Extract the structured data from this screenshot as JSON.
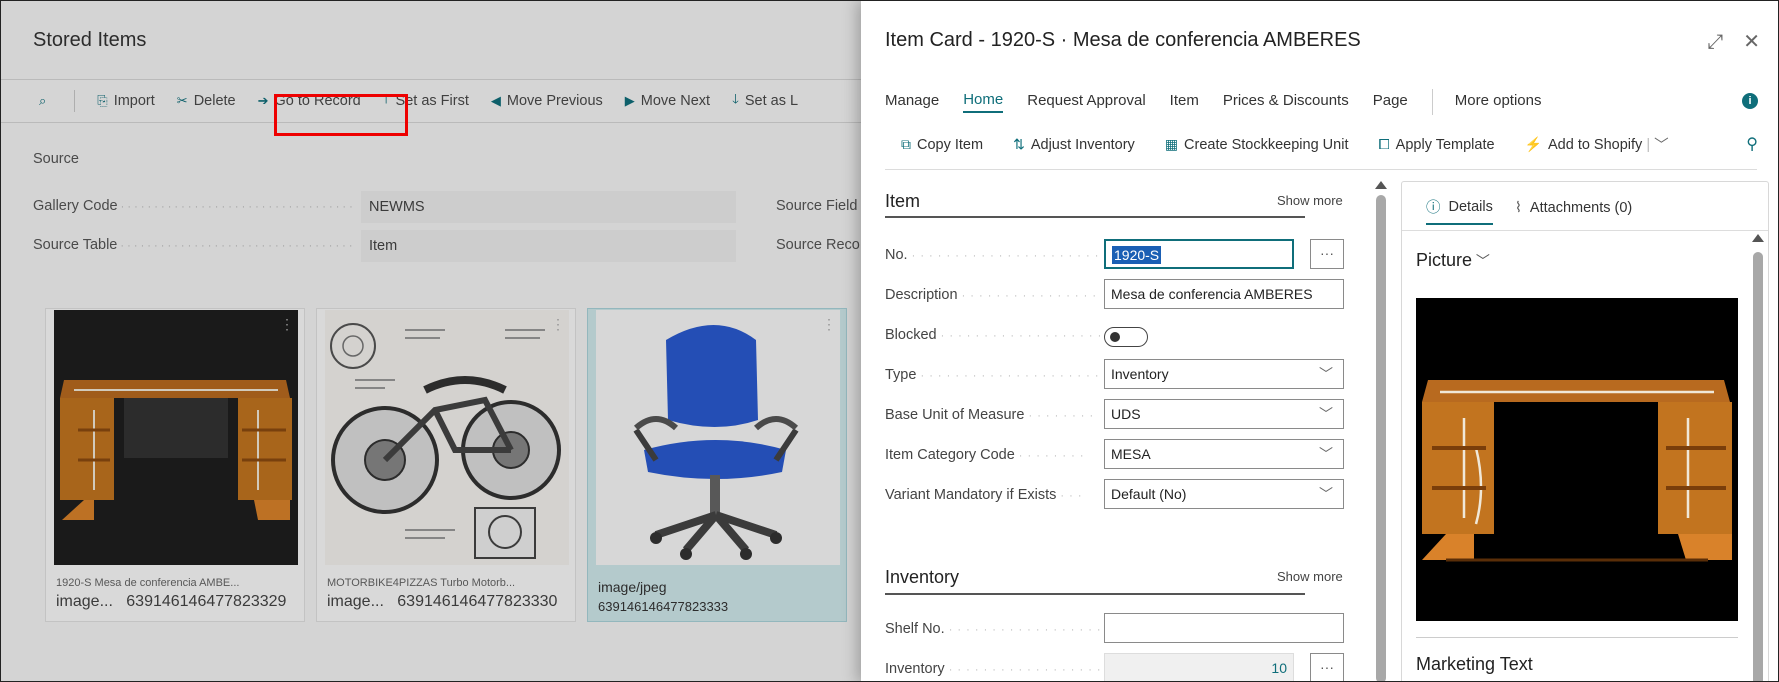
{
  "background_page": {
    "title": "Stored Items",
    "actions": [
      {
        "icon": "search-icon",
        "label": ""
      },
      {
        "icon": "import-icon",
        "label": "Import"
      },
      {
        "icon": "delete-icon",
        "label": "Delete"
      },
      {
        "icon": "arrow-right-icon",
        "label": "Go to Record"
      },
      {
        "icon": "arrow-up-icon",
        "label": "Set as First"
      },
      {
        "icon": "triangle-left-icon",
        "label": "Move Previous"
      },
      {
        "icon": "triangle-right-icon",
        "label": "Move Next"
      },
      {
        "icon": "arrow-down-icon",
        "label": "Set as L"
      }
    ],
    "source_heading": "Source",
    "gallery_code_label": "Gallery Code",
    "gallery_code_value": "NEWMS",
    "source_table_label": "Source Table",
    "source_table_value": "Item",
    "source_field_label": "Source Field",
    "source_record_label": "Source Reco",
    "tiles": [
      {
        "caption": "1920-S Mesa de conferencia AMBE...",
        "type": "image...",
        "id": "639146146477823329",
        "picture": "conference-table"
      },
      {
        "caption": "MOTORBIKE4PIZZAS Turbo Motorb...",
        "type": "image...",
        "id": "639146146477823330",
        "picture": "motorbike-sketch"
      },
      {
        "caption": "image/jpeg",
        "type": "",
        "id": "639146146477823333",
        "picture": "office-chair"
      }
    ]
  },
  "item_card": {
    "title": "Item Card - 1920-S · Mesa de conferencia AMBERES",
    "tabs": [
      "Manage",
      "Home",
      "Request Approval",
      "Item",
      "Prices & Discounts",
      "Page"
    ],
    "active_tab": "Home",
    "more_options": "More options",
    "commands": [
      {
        "icon": "copy-icon",
        "label": "Copy Item"
      },
      {
        "icon": "adjust-inventory-icon",
        "label": "Adjust Inventory"
      },
      {
        "icon": "stockkeeping-icon",
        "label": "Create Stockkeeping Unit"
      },
      {
        "icon": "template-icon",
        "label": "Apply Template"
      },
      {
        "icon": "shopify-icon",
        "label": "Add to Shopify"
      }
    ],
    "item_section": {
      "heading": "Item",
      "show_more": "Show more",
      "fields": {
        "no_label": "No.",
        "no_value": "1920-S",
        "description_label": "Description",
        "description_value": "Mesa de conferencia AMBERES",
        "blocked_label": "Blocked",
        "type_label": "Type",
        "type_value": "Inventory",
        "base_unit_label": "Base Unit of Measure",
        "base_unit_value": "UDS",
        "category_label": "Item Category Code",
        "category_value": "MESA",
        "variant_label": "Variant Mandatory if Exists",
        "variant_value": "Default (No)"
      }
    },
    "inventory_section": {
      "heading": "Inventory",
      "show_more": "Show more",
      "shelf_label": "Shelf No.",
      "shelf_value": "",
      "inventory_label": "Inventory",
      "inventory_value": "10"
    },
    "factbox": {
      "details_tab": "Details",
      "attachments_tab": "Attachments (0)",
      "picture_heading": "Picture",
      "marketing_heading": "Marketing Text"
    }
  },
  "colors": {
    "accent": "#0f6e7a",
    "highlight_box": "#e00000",
    "selected_tile": "#cfe8eb"
  }
}
